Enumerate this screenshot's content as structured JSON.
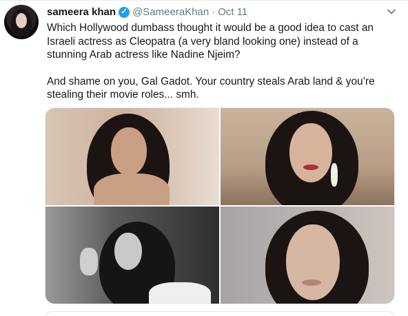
{
  "tweet": {
    "author_name": "sameera khan",
    "verified_mark": "✓",
    "handle": "@SameeraKhan",
    "separator": "·",
    "date": "Oct 11",
    "menu_icon": "chevron-down-icon",
    "text_paragraph_1": "Which Hollywood dumbass thought it would be a good idea to cast an Israeli actress as Cleopatra (a very bland looking one) instead of a stunning Arab actress like Nadine Njeim?",
    "text_paragraph_2": "And shame on you, Gal Gadot. Your country steals Arab land & you’re stealing their movie roles... smh.",
    "media_count": 4
  },
  "colors": {
    "text_primary": "#14171a",
    "text_secondary": "#657786",
    "verified_blue": "#1da1f2",
    "border": "#e6ecf0"
  }
}
